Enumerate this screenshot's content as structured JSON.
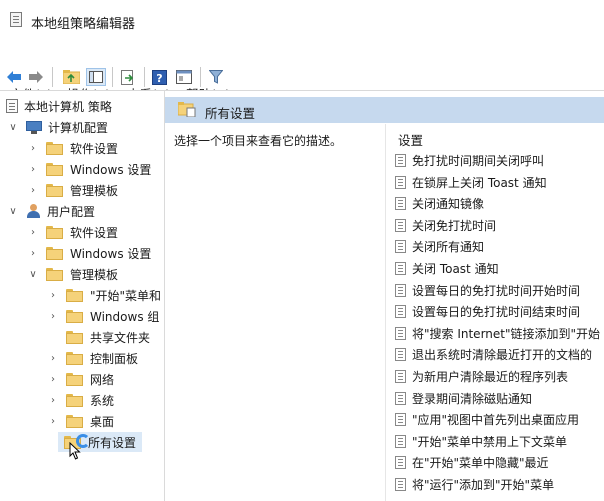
{
  "window": {
    "title": "本地组策略编辑器"
  },
  "menu": [
    {
      "label": "文件(F)"
    },
    {
      "label": "操作(A)"
    },
    {
      "label": "查看(V)"
    },
    {
      "label": "帮助(H)"
    }
  ],
  "toolbar": {
    "buttons": [
      "back-icon",
      "forward-icon",
      "up-folder-icon",
      "show-tree-icon",
      "export-icon",
      "help-icon",
      "properties-icon",
      "filter-icon"
    ]
  },
  "tree": {
    "root": "本地计算机 策略",
    "computer_config": "计算机配置",
    "computer_children": [
      "软件设置",
      "Windows 设置",
      "管理模板"
    ],
    "user_config": "用户配置",
    "user_children": [
      "软件设置",
      "Windows 设置",
      "管理模板"
    ],
    "admin_templates_children": [
      "\"开始\"菜单和",
      "Windows 组",
      "共享文件夹",
      "控制面板",
      "网络",
      "系统",
      "桌面",
      "所有设置"
    ]
  },
  "right_pane": {
    "header_title": "所有设置",
    "description": "选择一个项目来查看它的描述。",
    "column_header": "设置",
    "settings": [
      "免打扰时间期间关闭呼叫",
      "在锁屏上关闭 Toast 通知",
      "关闭通知镜像",
      "关闭免打扰时间",
      "关闭所有通知",
      "关闭 Toast 通知",
      "设置每日的免打扰时间开始时间",
      "设置每日的免打扰时间结束时间",
      "将\"搜索 Internet\"链接添加到\"开始",
      "退出系统时清除最近打开的文档的",
      "为新用户清除最近的程序列表",
      "登录期间清除磁贴通知",
      "\"应用\"视图中首先列出桌面应用",
      "\"开始\"菜单中禁用上下文菜单",
      "在\"开始\"菜单中隐藏\"最近",
      "将\"运行\"添加到\"开始\"菜单"
    ]
  }
}
